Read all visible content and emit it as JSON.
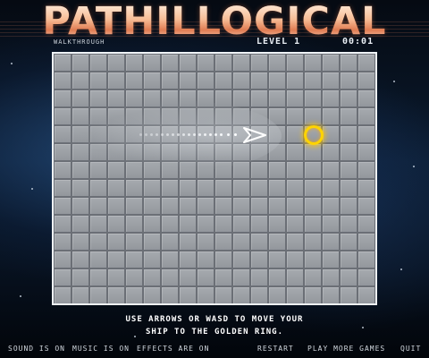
{
  "game": {
    "title": "PATHILLOGICAL",
    "walkthrough_label": "WALKTHROUGH",
    "level_label": "LEVEL 1",
    "timer": "00:01"
  },
  "board": {
    "columns": 18,
    "rows": 14,
    "ship_direction": "right",
    "goal": "golden ring"
  },
  "instructions": {
    "line1": "USE ARROWS OR WASD TO MOVE YOUR",
    "line2": "SHIP TO THE GOLDEN RING."
  },
  "footer": {
    "sound": "SOUND IS ON",
    "music": "MUSIC IS ON",
    "effects": "EFFECTS ARE ON",
    "restart": "RESTART",
    "more_games": "PLAY MORE GAMES",
    "quit": "QUIT"
  },
  "colors": {
    "ring": "#ffd400",
    "board": "#9a9ea4",
    "title": "#f8bd96"
  }
}
